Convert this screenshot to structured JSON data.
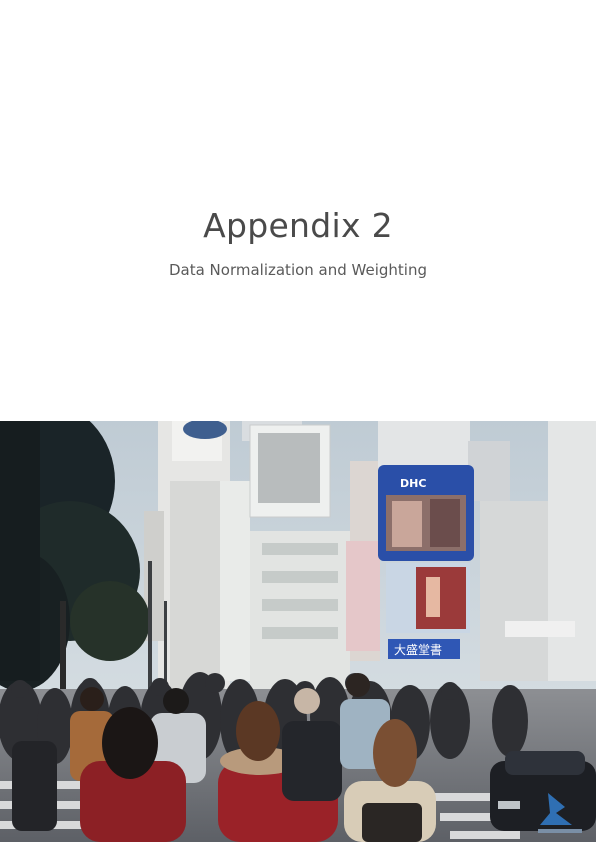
{
  "page": {
    "title": "Appendix 2",
    "subtitle": "Data Normalization and Weighting"
  },
  "photo": {
    "signs": {
      "dhc": "DHC",
      "crossing_sign": "大盛堂書"
    }
  },
  "colors": {
    "title": "#4a4a4a",
    "subtitle": "#5a5a5a",
    "sky": "#cdd7dd",
    "coat_red": "#9a2228",
    "dhc_blue": "#2a4fa8"
  }
}
